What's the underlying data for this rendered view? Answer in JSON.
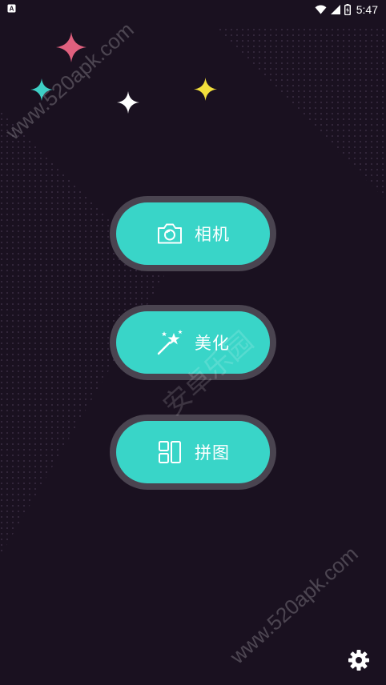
{
  "status_bar": {
    "time": "5:47",
    "notification_icon": "a-letter-icon",
    "wifi_icon": "wifi-icon",
    "signal_icon": "cell-signal-icon",
    "battery_icon": "battery-charging-icon"
  },
  "menu": {
    "camera": {
      "label": "相机",
      "icon": "camera-icon"
    },
    "beautify": {
      "label": "美化",
      "icon": "magic-wand-icon"
    },
    "collage": {
      "label": "拼图",
      "icon": "collage-grid-icon"
    }
  },
  "settings": {
    "icon": "gear-icon"
  },
  "watermark": {
    "url": "www.520apk.com",
    "overlay_text": "安卓乐园"
  },
  "colors": {
    "background": "#1a1120",
    "button_fill": "#39d5c8",
    "button_ring": "#4a4450",
    "sparkle_pink": "#e0607e",
    "sparkle_cyan": "#3ecfc5",
    "sparkle_white": "#ffffff",
    "sparkle_yellow": "#f2df3c"
  }
}
